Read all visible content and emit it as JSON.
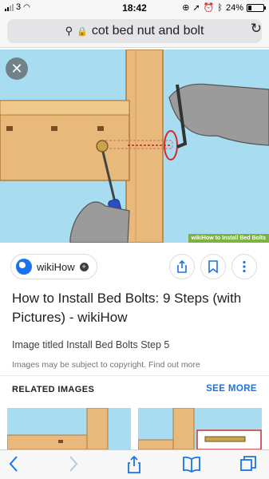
{
  "status_bar": {
    "carrier": "3",
    "time": "18:42",
    "battery_percent": "24%",
    "battery_level": 0.24
  },
  "url_bar": {
    "query": "cot bed nut and bolt"
  },
  "hero_image": {
    "watermark": "wikiHow to Install Bed Bolts"
  },
  "source": {
    "name": "wikiHow"
  },
  "result": {
    "title": "How to Install Bed Bolts: 9 Steps (with Pictures) - wikiHow",
    "subtitle": "Image titled Install Bed Bolts Step 5",
    "copyright": "Images may be subject to copyright. Find out more"
  },
  "related": {
    "heading": "RELATED IMAGES",
    "see_more": "SEE MORE"
  },
  "colors": {
    "accent": "#1a73e8",
    "sky": "#a8dcf0",
    "wood": "#e8b97a",
    "watermark_green": "#7cb342"
  },
  "icons": {
    "close": "close-icon",
    "share": "share-icon",
    "bookmark": "bookmark-icon",
    "more": "more-vertical-icon",
    "back": "chevron-left-icon",
    "forward": "chevron-right-icon",
    "tabs": "tabs-icon",
    "book": "bookmarks-book-icon",
    "reload": "reload-icon",
    "lock": "lock-icon",
    "search": "search-icon"
  }
}
